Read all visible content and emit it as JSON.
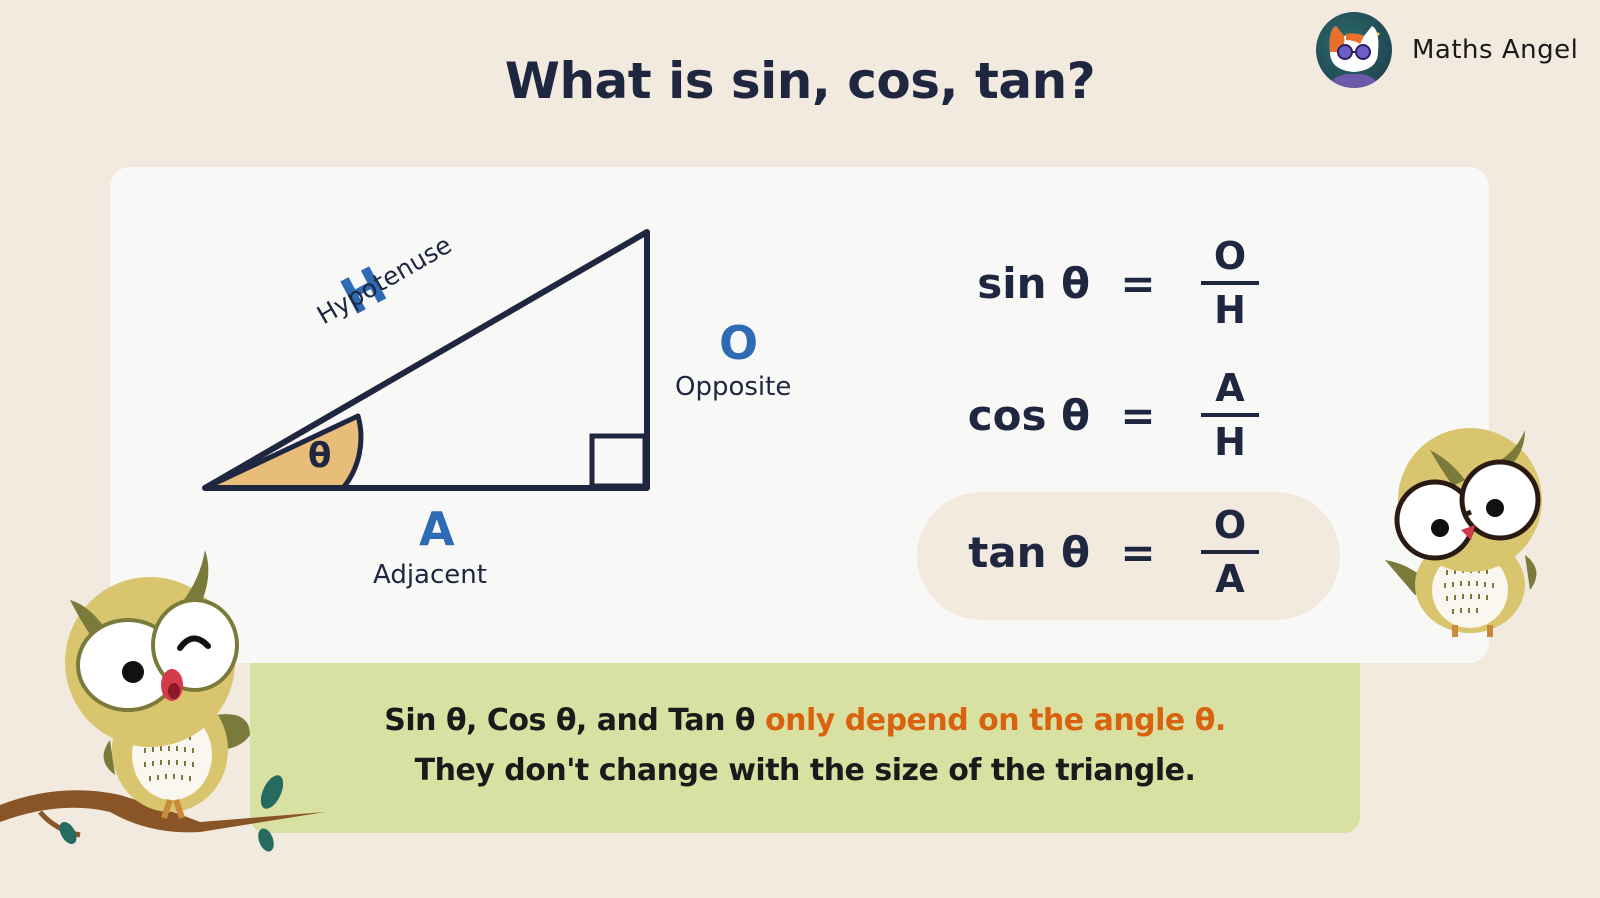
{
  "brand": {
    "name": "Maths Angel",
    "logo_icon": "cat-with-sunglasses-avatar"
  },
  "title": "What is sin, cos, tan?",
  "triangle": {
    "angle_symbol": "θ",
    "hypotenuse": {
      "letter": "H",
      "label": "Hypotenuse"
    },
    "opposite": {
      "letter": "O",
      "label": "Opposite"
    },
    "adjacent": {
      "letter": "A",
      "label": "Adjacent"
    },
    "right_angle_marker": true
  },
  "formulas": [
    {
      "fn": "sin θ",
      "eq": "=",
      "numerator": "O",
      "denominator": "H",
      "highlighted": false
    },
    {
      "fn": "cos θ",
      "eq": "=",
      "numerator": "A",
      "denominator": "H",
      "highlighted": false
    },
    {
      "fn": "tan θ",
      "eq": "=",
      "numerator": "O",
      "denominator": "A",
      "highlighted": true
    }
  ],
  "note": {
    "line1_plain": "Sin θ, Cos θ, and Tan θ ",
    "line1_highlight": "only depend on the angle θ.",
    "line2": "They don't change with the size of the triangle."
  },
  "colors": {
    "background": "#f2eadf",
    "panel": "#f8f8f6",
    "note_bg": "#d9e1a2",
    "highlight": "#d9620f",
    "letter_blue": "#2f6bb5",
    "text_dark": "#1f2640",
    "angle_fill": "#e8bd7a"
  },
  "decorations": [
    "owl-on-branch-winking",
    "owl-with-glasses"
  ]
}
